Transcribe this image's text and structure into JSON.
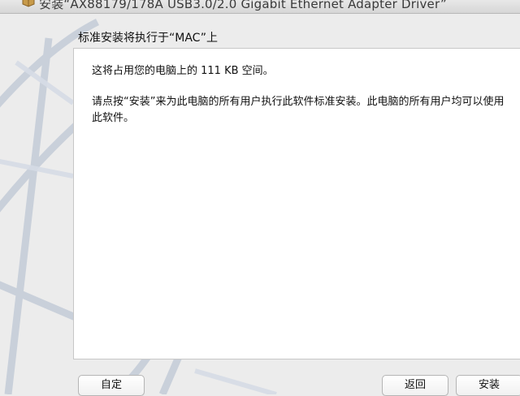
{
  "window": {
    "title": "安装“AX88179/178A USB3.0/2.0 Gigabit Ethernet Adapter Driver”",
    "icon": "package-icon"
  },
  "main": {
    "heading": "标准安装将执行于“MAC”上",
    "space_text": "这将占用您的电脑上的 111 KB 空间。",
    "description": "请点按“安装”来为此电脑的所有用户执行此软件标准安装。此电脑的所有用户均可以使用此软件。"
  },
  "buttons": {
    "customize": "自定",
    "back": "返回",
    "install": "安装"
  }
}
